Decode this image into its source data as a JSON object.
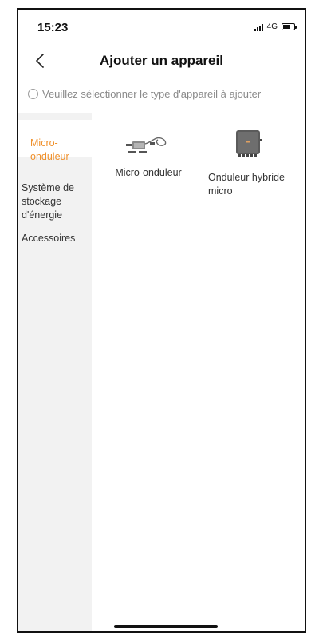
{
  "status_bar": {
    "time": "15:23",
    "network": "4G"
  },
  "nav": {
    "title": "Ajouter un appareil"
  },
  "hint": {
    "text": "Veuillez sélectionner le type d'appareil à ajouter"
  },
  "sidebar": {
    "items": [
      {
        "label": "Micro-\nonduleur",
        "active": true
      },
      {
        "label": "Système de\nstockage\nd'énergie",
        "active": false
      },
      {
        "label": "Accessoires",
        "active": false
      }
    ]
  },
  "products": [
    {
      "label": "Micro-onduleur",
      "icon": "micro-inverter-image"
    },
    {
      "label": "Onduleur hybride\nmicro",
      "icon": "hybrid-inverter-image"
    }
  ],
  "colors": {
    "accent": "#f0902a",
    "sidebar_bg": "#f2f2f2",
    "hint_text": "#8a8a8a"
  }
}
